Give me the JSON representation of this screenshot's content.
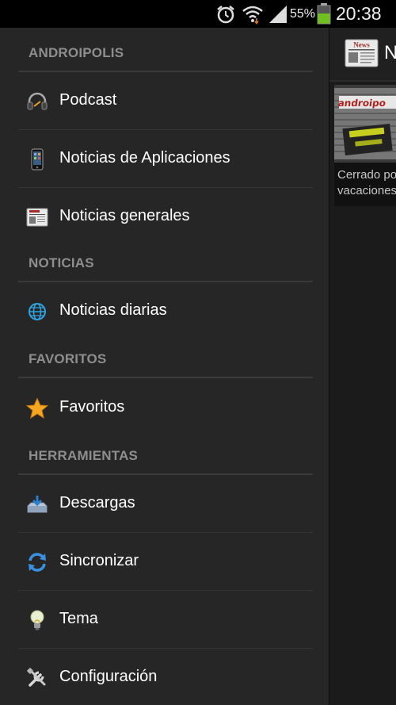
{
  "status_bar": {
    "battery_percent": "55%",
    "time": "20:38",
    "icons": [
      "alarm-icon",
      "wifi-icon",
      "signal-icon",
      "battery-icon"
    ]
  },
  "drawer": {
    "sections": [
      {
        "header": "ANDROIPOLIS",
        "items": [
          {
            "label": "Podcast",
            "icon": "headphones-icon"
          },
          {
            "label": "Noticias de Aplicaciones",
            "icon": "smartphone-icon"
          },
          {
            "label": "Noticias generales",
            "icon": "newspaper-icon"
          }
        ]
      },
      {
        "header": "NOTICIAS",
        "items": [
          {
            "label": "Noticias diarias",
            "icon": "globe-icon"
          }
        ]
      },
      {
        "header": "FAVORITOS",
        "items": [
          {
            "label": "Favoritos",
            "icon": "star-icon"
          }
        ]
      },
      {
        "header": "HERRAMIENTAS",
        "items": [
          {
            "label": "Descargas",
            "icon": "download-icon"
          },
          {
            "label": "Sincronizar",
            "icon": "sync-icon"
          },
          {
            "label": "Tema",
            "icon": "lightbulb-icon"
          },
          {
            "label": "Configuración",
            "icon": "tools-icon"
          }
        ]
      }
    ]
  },
  "main": {
    "action_bar_title": "N",
    "logo_text": "News",
    "article": {
      "title_line1": "Cerrado po",
      "title_line2": "vacaciones"
    }
  },
  "colors": {
    "drawer_bg": "#262626",
    "header_text": "#8e8e8e",
    "divider": "#3a3a3a",
    "item_text": "#ffffff"
  }
}
